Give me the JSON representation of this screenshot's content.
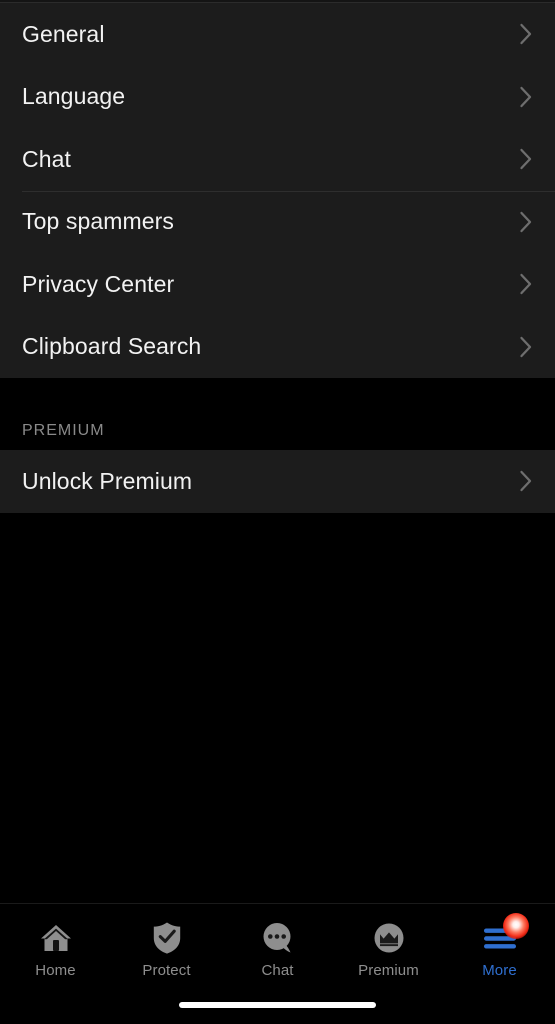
{
  "screen": {
    "background": "#000000",
    "row_background": "#1c1c1c",
    "accent": "#2f6fd0",
    "badge_color": "#f22a16"
  },
  "settings": {
    "group_one": [
      {
        "label": "General",
        "icon": "chevron-right-icon",
        "separator_above": false
      },
      {
        "label": "Language",
        "icon": "chevron-right-icon",
        "separator_above": false
      },
      {
        "label": "Chat",
        "icon": "chevron-right-icon",
        "separator_above": false
      },
      {
        "label": "Top spammers",
        "icon": "chevron-right-icon",
        "separator_above": true
      },
      {
        "label": "Privacy Center",
        "icon": "chevron-right-icon",
        "separator_above": false
      },
      {
        "label": "Clipboard Search",
        "icon": "chevron-right-icon",
        "separator_above": false
      }
    ],
    "premium_section": {
      "header": "PREMIUM",
      "rows": [
        {
          "label": "Unlock Premium",
          "icon": "chevron-right-icon"
        }
      ]
    }
  },
  "tabbar": {
    "items": [
      {
        "label": "Home",
        "icon": "home-icon",
        "active": false
      },
      {
        "label": "Protect",
        "icon": "shield-check-icon",
        "active": false
      },
      {
        "label": "Chat",
        "icon": "chat-bubble-icon",
        "active": false
      },
      {
        "label": "Premium",
        "icon": "crown-circle-icon",
        "active": false
      },
      {
        "label": "More",
        "icon": "hamburger-menu-icon",
        "active": true,
        "badge": true
      }
    ]
  },
  "system": {
    "home_indicator": "home-indicator"
  }
}
